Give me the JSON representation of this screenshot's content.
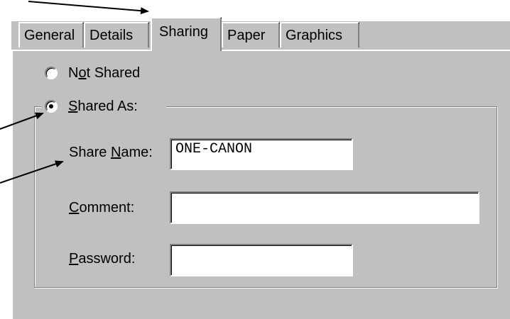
{
  "tabs": [
    "General",
    "Details",
    "Sharing",
    "Paper",
    "Graphics"
  ],
  "active_tab": "Sharing",
  "sharing": {
    "not_shared": {
      "pre": "N",
      "u": "o",
      "post": "t Shared"
    },
    "shared_as": {
      "pre": "",
      "u": "S",
      "post": "hared As:"
    },
    "selected": "shared_as",
    "share_name": {
      "pre": "Share ",
      "u": "N",
      "post": "ame:",
      "value": "ONE-CANON"
    },
    "comment": {
      "pre": "",
      "u": "C",
      "post": "omment:",
      "value": ""
    },
    "password": {
      "pre": "",
      "u": "P",
      "post": "assword:",
      "value": ""
    }
  },
  "colors": {
    "face": "#c0c0c0",
    "highlight": "#ffffff",
    "shadow": "#808080",
    "dark": "#000000"
  }
}
